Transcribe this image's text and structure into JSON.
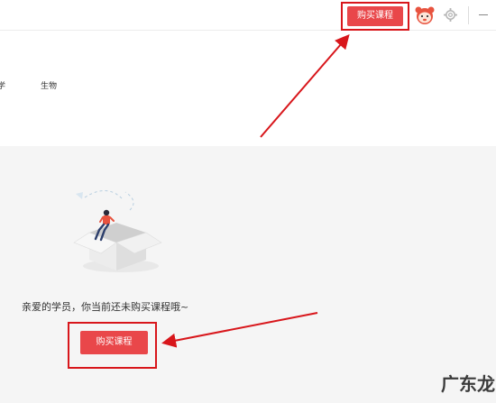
{
  "header": {
    "buy_button_label": "购买课程",
    "avatar_icon": "avatar-icon",
    "settings_icon": "gear-icon",
    "minimize_icon": "minimize-icon"
  },
  "subjects": {
    "tabs": [
      {
        "label": "学"
      },
      {
        "label": "生物"
      }
    ]
  },
  "empty_state": {
    "message": "亲爱的学员，你当前还未购买课程哦~",
    "buy_button_label": "购买课程",
    "illustration_icon": "empty-box-icon"
  },
  "annotations": {
    "highlight_color": "#d8161b",
    "button_color": "#e9474a"
  },
  "watermark": {
    "text": "广东龙网"
  }
}
